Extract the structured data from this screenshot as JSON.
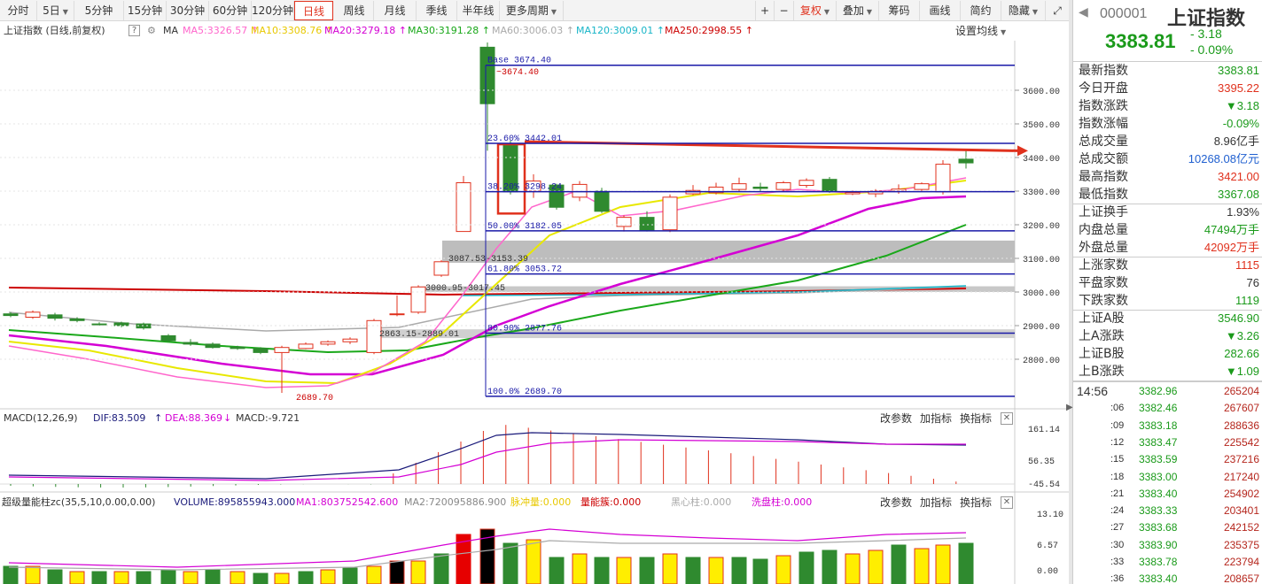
{
  "toolbar": {
    "periods": [
      "分时",
      "5日",
      "5分钟",
      "15分钟",
      "30分钟",
      "60分钟",
      "120分钟",
      "日线",
      "周线",
      "月线",
      "季线",
      "半年线",
      "更多周期"
    ],
    "active_period": "日线",
    "right_buttons": [
      "+",
      "−",
      "复权",
      "叠加",
      "筹码",
      "画线",
      "简约",
      "隐藏"
    ],
    "restore_icon": "restore-icon"
  },
  "ma_row": {
    "title": "上证指数 (日线,前复权)",
    "help": "?",
    "ma_label": "MA",
    "items": [
      {
        "text": "MA5:3326.57",
        "color": "#ff66cc",
        "arrow": "↑"
      },
      {
        "text": "MA10:3308.76",
        "color": "#e8c800",
        "arrow": "↑"
      },
      {
        "text": "MA20:3279.18",
        "color": "#d400d4",
        "arrow": "↑"
      },
      {
        "text": "MA30:3191.28",
        "color": "#1aa81a",
        "arrow": "↑"
      },
      {
        "text": "MA60:3006.03",
        "color": "#aaaaaa",
        "arrow": "↑"
      },
      {
        "text": "MA120:3009.01",
        "color": "#19b5c8",
        "arrow": "↑"
      },
      {
        "text": "MA250:2998.55",
        "color": "#cc0000",
        "arrow": "↑"
      }
    ],
    "settings": "设置均线"
  },
  "main_chart": {
    "price_axis": [
      "3600.00",
      "3500.00",
      "3400.00",
      "3300.00",
      "3200.00",
      "3100.00",
      "3000.00",
      "2900.00",
      "2800.00"
    ],
    "fib": [
      {
        "label": "Base",
        "price": "3674.40"
      },
      {
        "label": "23.60%",
        "price": "3442.01"
      },
      {
        "label": "38.20%",
        "price": "3298.24"
      },
      {
        "label": "50.00%",
        "price": "3182.05"
      },
      {
        "label": "61.80%",
        "price": "3053.72"
      },
      {
        "label": "80.90%",
        "price": "2877.76"
      },
      {
        "label": "100.0%",
        "price": "2689.70"
      }
    ],
    "annotations": [
      "~3674.40",
      "3087.53-3153.39",
      "3000.95-3017.45",
      "2863.15-2889.01",
      "2689.70"
    ]
  },
  "macd": {
    "header": [
      "MACD(12,26,9)",
      "DIF:83.509",
      "DEA:88.369",
      "MACD:-9.721"
    ],
    "axis": [
      "161.14",
      "56.35",
      "-45.54"
    ],
    "buttons": [
      "改参数",
      "加指标",
      "换指标"
    ]
  },
  "volume": {
    "header": [
      "超级量能柱zc(35,5,10,0.00,0.00)",
      "VOLUME:895855943.000",
      "MA1:803752542.600",
      "MA2:720095886.900",
      "脉冲量:0.000",
      "量能簇:0.000",
      "黑心柱:0.000",
      "洗盘柱:0.000"
    ],
    "axis": [
      "13.10",
      "6.57",
      "0.00"
    ],
    "buttons": [
      "改参数",
      "加指标",
      "换指标"
    ]
  },
  "sidebar": {
    "code": "000001",
    "name": "上证指数",
    "price": "3383.81",
    "change": "- 3.18",
    "change_pct": "- 0.09%",
    "stats": [
      {
        "k": "最新指数",
        "v": "3383.81",
        "c": "green"
      },
      {
        "k": "今日开盘",
        "v": "3395.22",
        "c": "red"
      },
      {
        "k": "指数涨跌",
        "v": "▼3.18",
        "c": "green"
      },
      {
        "k": "指数涨幅",
        "v": "-0.09%",
        "c": "green"
      },
      {
        "k": "总成交量",
        "v": "8.96亿手",
        "c": "dark"
      },
      {
        "k": "总成交额",
        "v": "10268.08亿元",
        "c": "blue"
      },
      {
        "k": "最高指数",
        "v": "3421.00",
        "c": "red"
      },
      {
        "k": "最低指数",
        "v": "3367.08",
        "c": "green"
      },
      {
        "k": "上证换手",
        "v": "1.93%",
        "c": "dark"
      },
      {
        "k": "内盘总量",
        "v": "47494万手",
        "c": "green"
      },
      {
        "k": "外盘总量",
        "v": "42092万手",
        "c": "red"
      },
      {
        "k": "上涨家数",
        "v": "1115",
        "c": "red"
      },
      {
        "k": "平盘家数",
        "v": "76",
        "c": "dark"
      },
      {
        "k": "下跌家数",
        "v": "1119",
        "c": "green"
      },
      {
        "k": "上证A股",
        "v": "3546.90",
        "c": "green"
      },
      {
        "k": "上A涨跌",
        "v": "▼3.26",
        "c": "green"
      },
      {
        "k": "上证B股",
        "v": "282.66",
        "c": "green"
      },
      {
        "k": "上B涨跌",
        "v": "▼1.09",
        "c": "green"
      }
    ],
    "ticks": [
      {
        "t": "14:56",
        "p": "3382.96",
        "v": "265204"
      },
      {
        "t": ":06",
        "p": "3382.46",
        "v": "267607"
      },
      {
        "t": ":09",
        "p": "3383.18",
        "v": "288636"
      },
      {
        "t": ":12",
        "p": "3383.47",
        "v": "225542"
      },
      {
        "t": ":15",
        "p": "3383.59",
        "v": "237216"
      },
      {
        "t": ":18",
        "p": "3383.00",
        "v": "217240"
      },
      {
        "t": ":21",
        "p": "3383.40",
        "v": "254902"
      },
      {
        "t": ":24",
        "p": "3383.33",
        "v": "203401"
      },
      {
        "t": ":27",
        "p": "3383.68",
        "v": "242152"
      },
      {
        "t": ":30",
        "p": "3383.90",
        "v": "235375"
      },
      {
        "t": ":33",
        "p": "3383.78",
        "v": "223794"
      },
      {
        "t": ":36",
        "p": "3383.40",
        "v": "208657"
      }
    ]
  },
  "colors": {
    "up": "#e0311d",
    "down": "#2f8a2f",
    "fib_line": "#1a1aa8",
    "accent": "#e0311d"
  }
}
